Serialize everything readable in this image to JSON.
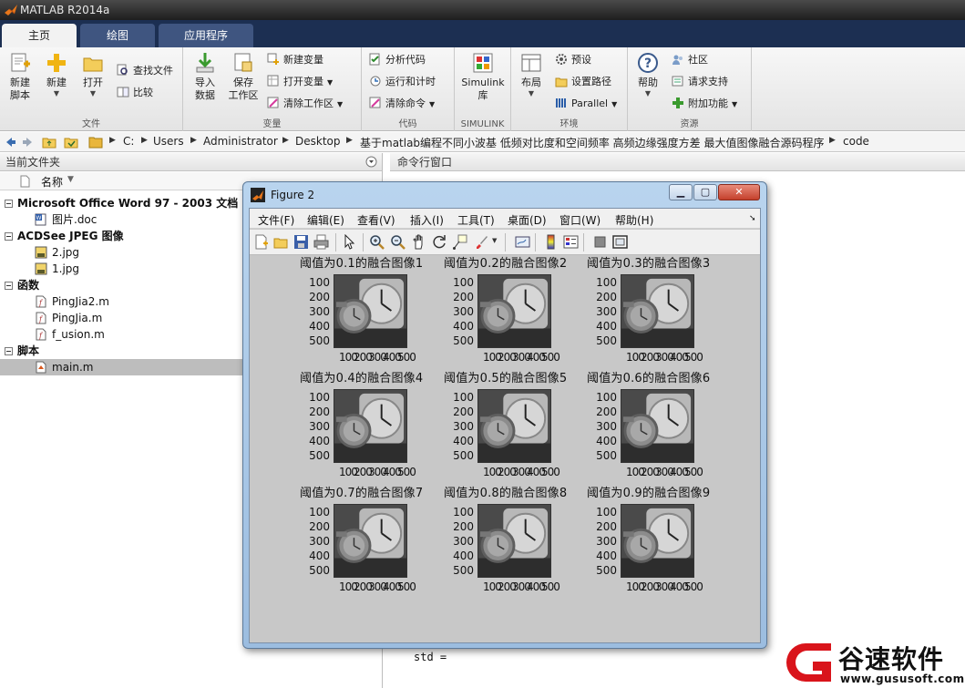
{
  "app": {
    "title": "MATLAB R2014a"
  },
  "tabs": [
    {
      "label": "主页",
      "active": true
    },
    {
      "label": "绘图",
      "active": false
    },
    {
      "label": "应用程序",
      "active": false
    }
  ],
  "ribbon": {
    "file": {
      "label": "文件",
      "new_script": "新建\n脚本",
      "new": "新建",
      "open": "打开",
      "find_files": "查找文件",
      "compare": "比较"
    },
    "variable": {
      "label": "变量",
      "import_data": "导入\n数据",
      "save_workspace": "保存\n工作区",
      "new_variable": "新建变量",
      "open_variable": "打开变量",
      "clear_workspace": "清除工作区"
    },
    "code": {
      "label": "代码",
      "analyze_code": "分析代码",
      "run_and_time": "运行和计时",
      "clear_commands": "清除命令"
    },
    "simulink": {
      "label": "SIMULINK",
      "library": "Simulink\n库"
    },
    "environment": {
      "label": "环境",
      "layout": "布局",
      "preferences": "预设",
      "set_path": "设置路径",
      "parallel": "Parallel"
    },
    "resources": {
      "label": "资源",
      "help": "帮助",
      "community": "社区",
      "request_support": "请求支持",
      "add_ons": "附加功能"
    }
  },
  "address": {
    "crumbs": [
      "C:",
      "Users",
      "Administrator",
      "Desktop",
      "基于matlab编程不同小波基 低频对比度和空间频率 高频边缘强度方差 最大值图像融合源码程序",
      "code"
    ]
  },
  "current_folder": {
    "title": "当前文件夹",
    "column_name": "名称",
    "sections": [
      {
        "label": "Microsoft Office Word 97 - 2003 文档",
        "files": [
          {
            "name": "图片.doc",
            "icon": "word-doc-icon"
          }
        ]
      },
      {
        "label": "ACDSee JPEG 图像",
        "files": [
          {
            "name": "2.jpg",
            "icon": "jpeg-icon"
          },
          {
            "name": "1.jpg",
            "icon": "jpeg-icon"
          }
        ]
      },
      {
        "label": "函数",
        "files": [
          {
            "name": "PingJia2.m",
            "icon": "function-icon"
          },
          {
            "name": "PingJia.m",
            "icon": "function-icon"
          },
          {
            "name": "f_usion.m",
            "icon": "function-icon"
          }
        ]
      },
      {
        "label": "脚本",
        "files": [
          {
            "name": "main.m",
            "icon": "script-icon",
            "selected": true
          }
        ]
      }
    ]
  },
  "command_window": {
    "title": "命令行窗口",
    "last_line": "std ="
  },
  "figure": {
    "title": "Figure 2",
    "menus": [
      "文件(F)",
      "编辑(E)",
      "查看(V)",
      "插入(I)",
      "工具(T)",
      "桌面(D)",
      "窗口(W)",
      "帮助(H)"
    ],
    "toolbar_icons": [
      "new-figure-icon",
      "open-file-icon",
      "save-icon",
      "print-icon",
      "pointer-icon",
      "zoom-in-icon",
      "zoom-out-icon",
      "pan-icon",
      "rotate-icon",
      "data-cursor-icon",
      "brush-icon",
      "link-plot-icon",
      "colorbar-icon",
      "legend-icon",
      "hide-plot-tools-icon",
      "show-plot-tools-icon"
    ],
    "subplots": [
      {
        "title": "阈值为0.1的融合图像1"
      },
      {
        "title": "阈值为0.2的融合图像2"
      },
      {
        "title": "阈值为0.3的融合图像3"
      },
      {
        "title": "阈值为0.4的融合图像4"
      },
      {
        "title": "阈值为0.5的融合图像5"
      },
      {
        "title": "阈值为0.6的融合图像6"
      },
      {
        "title": "阈值为0.7的融合图像7"
      },
      {
        "title": "阈值为0.8的融合图像8"
      },
      {
        "title": "阈值为0.9的融合图像9"
      }
    ],
    "y_ticks": [
      "100",
      "200",
      "300",
      "400",
      "500"
    ],
    "x_ticks": [
      "100",
      "200",
      "300",
      "400",
      "500"
    ]
  },
  "watermark": {
    "name": "谷速软件",
    "url": "www.gususoft.com"
  },
  "colors": {
    "ribbon_tabstrip": "#1c2f52",
    "figure_frame": "#9cbde0",
    "figure_background": "#c8c8c8",
    "watermark_red": "#d9141b"
  }
}
